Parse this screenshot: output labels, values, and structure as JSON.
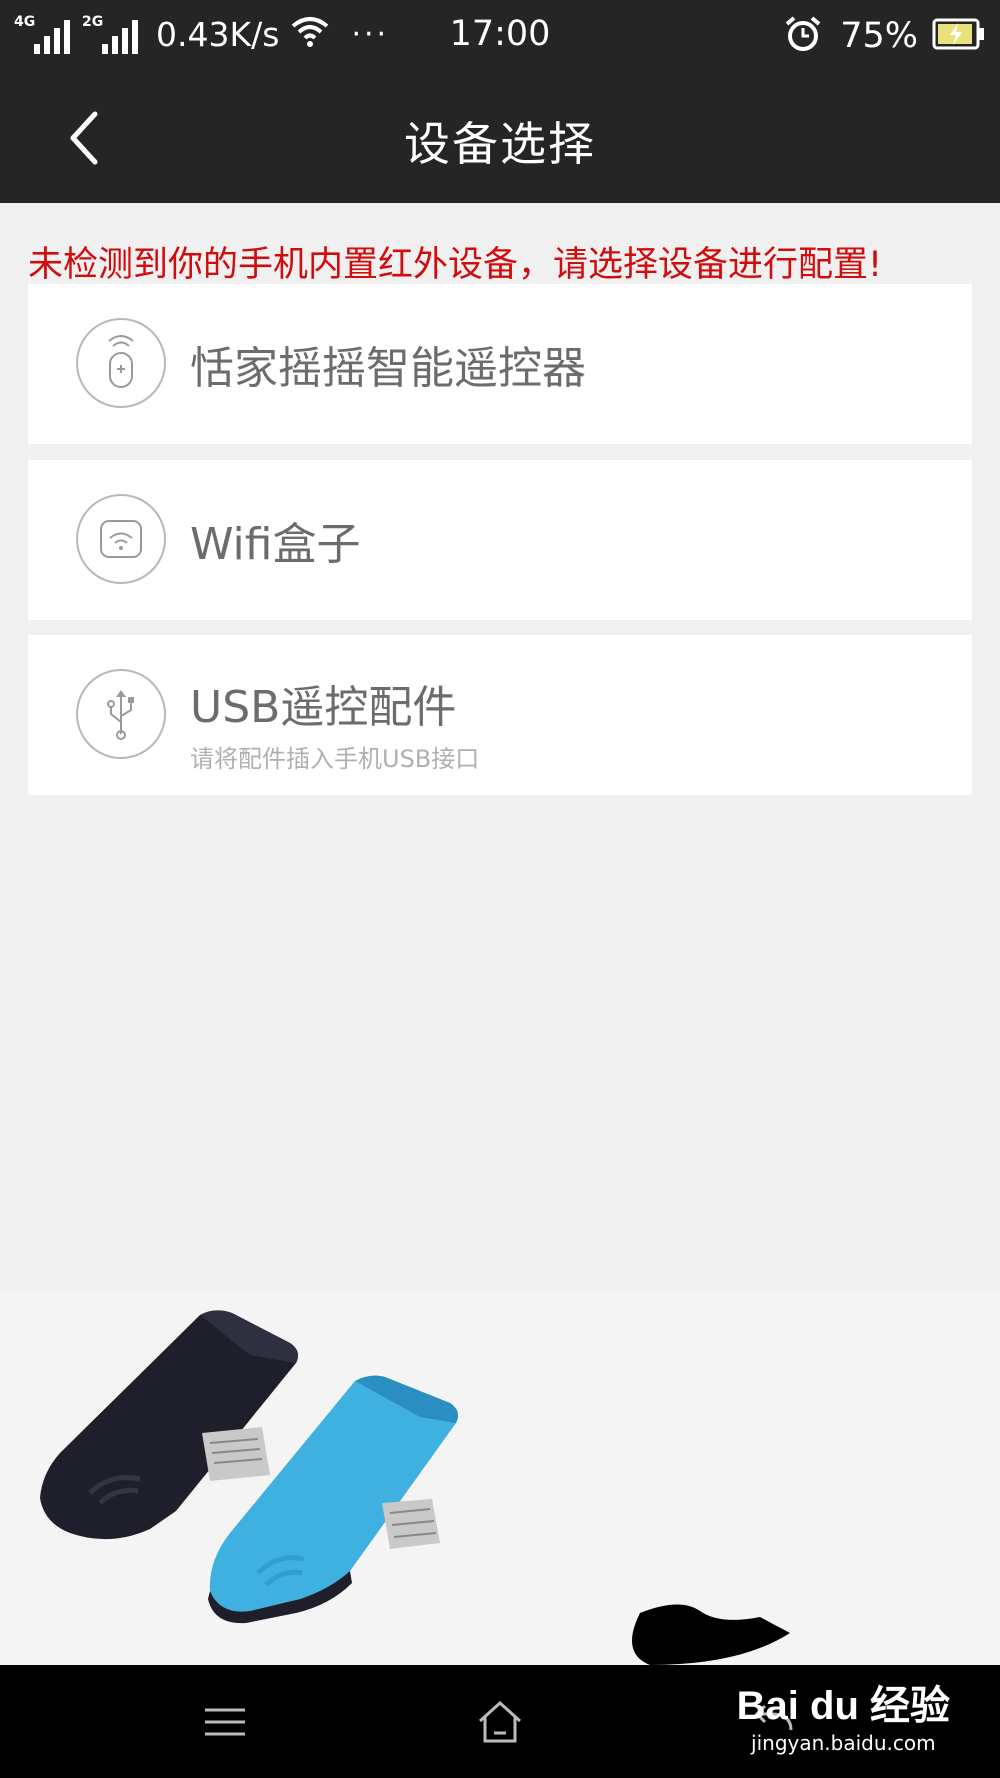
{
  "status_bar": {
    "signal_1_label": "4G",
    "signal_2_label": "2G",
    "net_speed": "0.43K/s",
    "more": "···",
    "time": "17:00",
    "battery": "75%"
  },
  "header": {
    "title": "设备选择"
  },
  "warning_text": "未检测到你的手机内置红外设备，请选择设备进行配置!",
  "devices": [
    {
      "label": "恬家摇摇智能遥控器",
      "icon": "remote-icon"
    },
    {
      "label": "Wifi盒子",
      "icon": "wifi-box-icon"
    },
    {
      "label": "USB遥控配件",
      "sublabel": "请将配件插入手机USB接口",
      "icon": "usb-icon"
    }
  ],
  "watermark": {
    "brand": "Bai du 经验",
    "url": "jingyan.baidu.com"
  },
  "colors": {
    "bar_bg": "#252525",
    "warning": "#d00c0c",
    "page_bg": "#f1f0f1",
    "usb_black": "#1e1f2b",
    "usb_blue": "#3fb1e0"
  }
}
